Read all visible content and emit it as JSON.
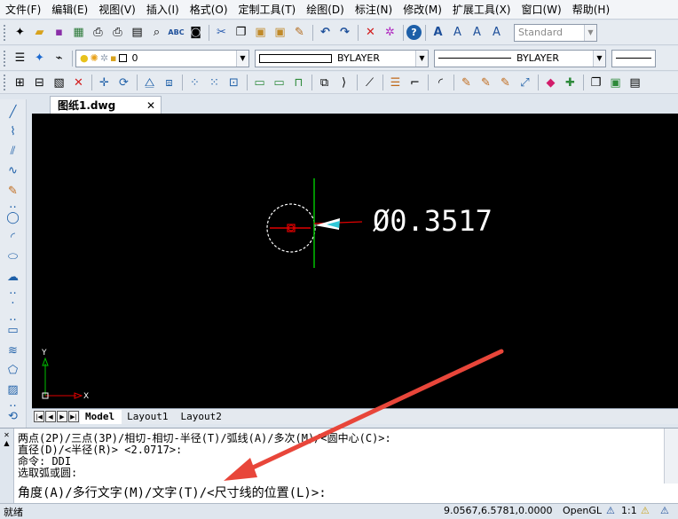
{
  "menubar": {
    "items": [
      "文件(F)",
      "编辑(E)",
      "视图(V)",
      "插入(I)",
      "格式(O)",
      "定制工具(T)",
      "绘图(D)",
      "标注(N)",
      "修改(M)",
      "扩展工具(X)",
      "窗口(W)",
      "帮助(H)"
    ]
  },
  "toolbar": {
    "text_style": "Standard",
    "layer": "0",
    "color": "BYLAYER",
    "linetype": "BYLAYER"
  },
  "document": {
    "tab_label": "图纸1.dwg",
    "close_glyph": "✕"
  },
  "drawing": {
    "dimension_text": "Ø0.3517",
    "ucs_y": "Y",
    "ucs_x": "X",
    "colors": {
      "background": "#000000",
      "circle": "#ffffff",
      "crosshair_v": "#00c000",
      "crosshair_h": "#e00000",
      "center": "#e00000"
    }
  },
  "layout_tabs": [
    "Model",
    "Layout1",
    "Layout2"
  ],
  "command_history": [
    "两点(2P)/三点(3P)/相切-相切-半径(T)/弧线(A)/多次(M)/<圆中心(C)>:",
    "直径(D)/<半径(R)> <2.0717>:",
    "命令:  DDI",
    "选取弧或圆:"
  ],
  "command_prompt": "角度(A)/多行文字(M)/文字(T)/<尺寸线的位置(L)>:",
  "statusbar": {
    "status": "就绪",
    "coords": "9.0567,6.5781,0.0000",
    "renderer": "OpenGL",
    "scale": "1:1"
  },
  "annotation": {
    "arrow_color": "#e8463a"
  }
}
